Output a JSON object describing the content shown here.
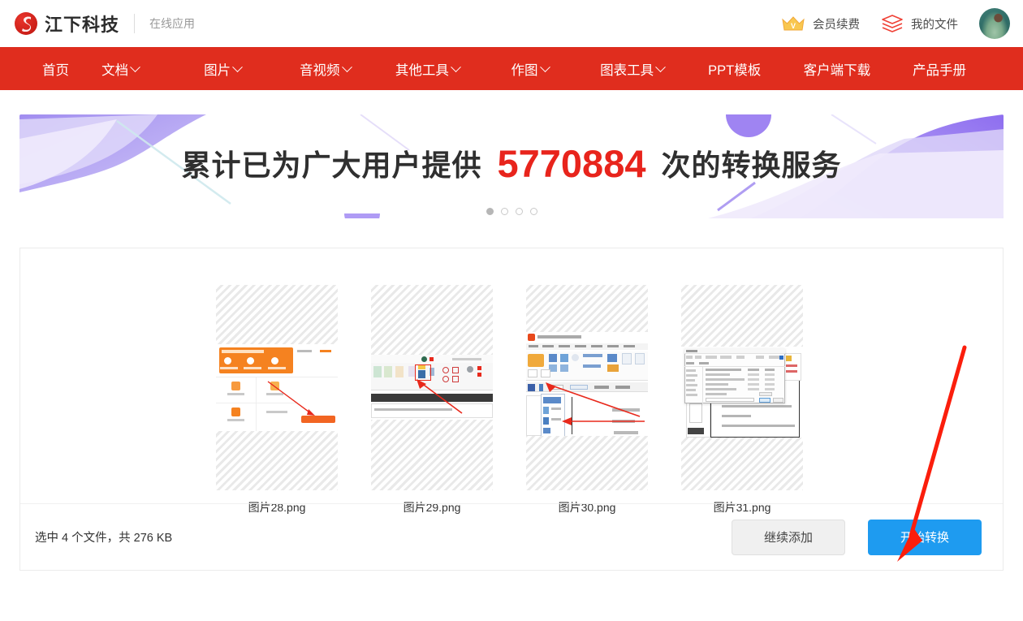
{
  "header": {
    "brand_name": "江下科技",
    "sub_brand": "在线应用",
    "logo_icon": "jiangxia-logo-icon",
    "vip_label": "会员续费",
    "vip_icon": "crown-icon",
    "files_label": "我的文件",
    "files_icon": "layers-icon",
    "avatar_icon": "user-avatar"
  },
  "nav": {
    "items": [
      {
        "label": "首页",
        "dropdown": false
      },
      {
        "label": "文档",
        "dropdown": true
      },
      {
        "label": "图片",
        "dropdown": true
      },
      {
        "label": "音视频",
        "dropdown": true
      },
      {
        "label": "其他工具",
        "dropdown": true
      },
      {
        "label": "作图",
        "dropdown": true
      },
      {
        "label": "图表工具",
        "dropdown": true
      },
      {
        "label": "PPT模板",
        "dropdown": false
      },
      {
        "label": "客户端下载",
        "dropdown": false
      },
      {
        "label": "产品手册",
        "dropdown": false
      }
    ],
    "background_color": "#e02d1e"
  },
  "banner": {
    "text_before": "累计已为广大用户提供",
    "count": "5770884",
    "text_after": "次的转换服务",
    "count_color": "#e8241c",
    "dots_total": 4,
    "dot_active_index": 0
  },
  "files": {
    "items": [
      {
        "name": "图片28.png"
      },
      {
        "name": "图片29.png"
      },
      {
        "name": "图片30.png"
      },
      {
        "name": "图片31.png"
      }
    ]
  },
  "footer": {
    "selection_text": "选中 4 个文件，共 276 KB",
    "selected_count": "4",
    "total_size": "276 KB",
    "secondary_button": "继续添加",
    "primary_button": "开始转换",
    "primary_color": "#1e9bf0"
  },
  "annotation": {
    "arrow_color": "#fb1e0c",
    "arrow_name": "red-pointer-arrow"
  }
}
